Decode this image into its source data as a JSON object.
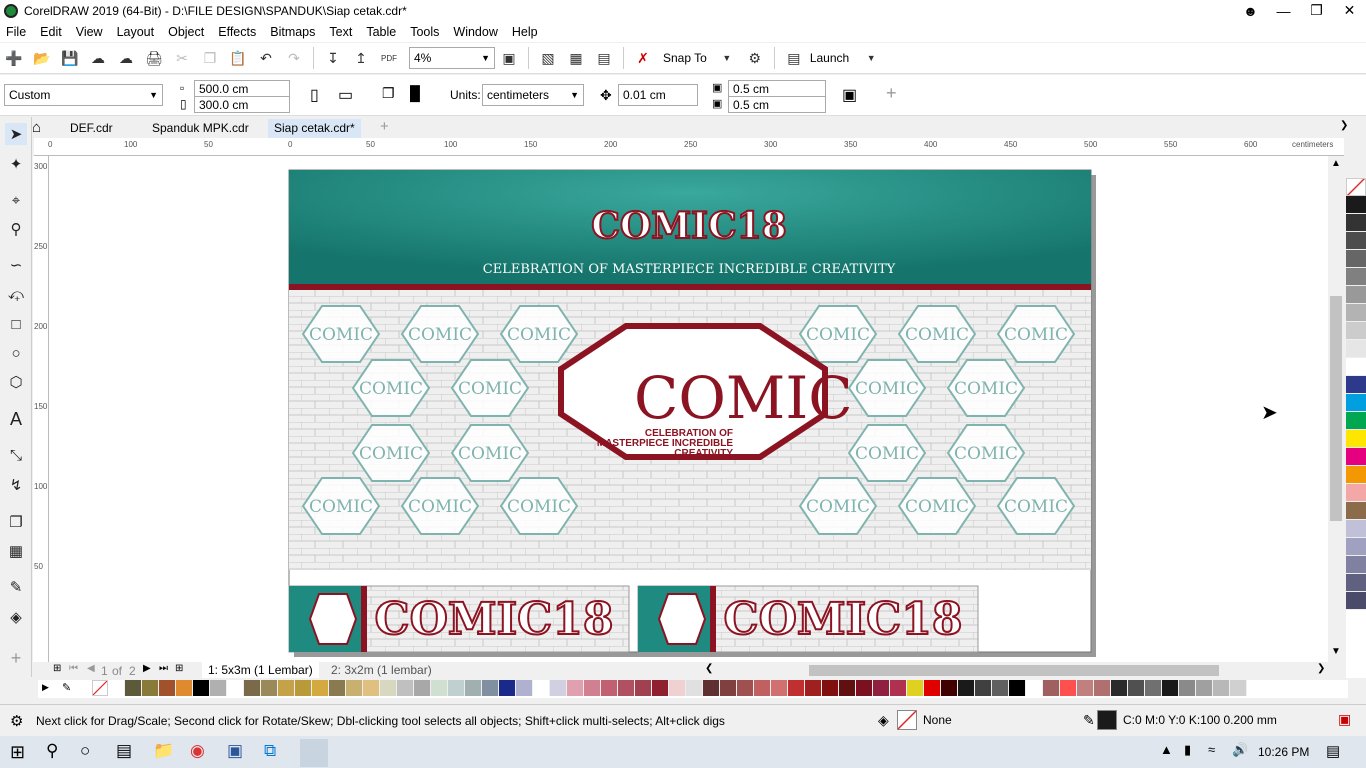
{
  "window": {
    "title": "CorelDRAW 2019 (64-Bit) - D:\\FILE DESIGN\\SPANDUK\\Siap cetak.cdr*"
  },
  "menu": [
    "File",
    "Edit",
    "View",
    "Layout",
    "Object",
    "Effects",
    "Bitmaps",
    "Text",
    "Table",
    "Tools",
    "Window",
    "Help"
  ],
  "toolbar": {
    "zoom": "4%",
    "snap_to": "Snap To",
    "launch": "Launch"
  },
  "property_bar": {
    "preset": "Custom",
    "width": "500.0 cm",
    "height": "300.0 cm",
    "units_label": "Units:",
    "units_value": "centimeters",
    "nudge": "0.01 cm",
    "dup_x": "0.5 cm",
    "dup_y": "0.5 cm"
  },
  "doc_tabs": [
    "DEF.cdr",
    "Spanduk MPK.cdr",
    "Siap cetak.cdr*"
  ],
  "ruler": {
    "unit": "centimeters",
    "h_ticks": [
      "0",
      "100",
      "50",
      "0",
      "50",
      "100",
      "150",
      "200",
      "250",
      "300",
      "350",
      "400",
      "450",
      "500",
      "550",
      "600"
    ],
    "v_ticks": [
      "300",
      "250",
      "200",
      "150",
      "100",
      "50"
    ]
  },
  "design": {
    "logo": "COMIC18",
    "tagline": "CELEBRATION OF MASTERPIECE INCREDIBLE CREATIVITY",
    "big_logo": "COMIC",
    "big_logo_sub": [
      "CELEBRATION OF",
      "MASTERPIECE INCREDIBLE",
      "CREATIVITY"
    ],
    "small_logo": "COMIC",
    "strip_text": "COMIC18"
  },
  "page_nav": {
    "counter": "1",
    "of": "of",
    "total": "2",
    "page1": "1: 5x3m (1 Lembar)",
    "page2": "2: 3x2m (1 lembar)"
  },
  "status": {
    "hint": "Next click for Drag/Scale; Second click for Rotate/Skew; Dbl-clicking tool selects all objects; Shift+click multi-selects; Alt+click digs",
    "fill": "None",
    "outline": "C:0 M:0 Y:0 K:100  0.200 mm"
  },
  "taskbar": {
    "time": "10:26 PM"
  },
  "colors": {
    "teal": "#1e8a80",
    "maroon": "#8c1422",
    "brick": "#ededed",
    "hex_outline": "#7fb3ae",
    "palette_right": [
      "#1a1a1a",
      "#333333",
      "#4d4d4d",
      "#666666",
      "#808080",
      "#999999",
      "#b3b3b3",
      "#cccccc",
      "#e6e6e6",
      "#ffffff",
      "#2d3a8c",
      "#00a0e0",
      "#00a650",
      "#ffe600",
      "#e4007f",
      "#f39800",
      "#f4a7a7",
      "#8b6b4a",
      "#c0c0d8",
      "#a0a0c0",
      "#8080a0",
      "#606080",
      "#4a4a6a"
    ],
    "palette_bottom": [
      "#ffffff",
      "#5c5a3a",
      "#8a7a3a",
      "#a0522d",
      "#e08a30",
      "#000000",
      "#b0b0b0",
      "#ffffff",
      "#7a6a4a",
      "#9a8a5a",
      "#c4a24a",
      "#b89a3a",
      "#d4aa40",
      "#8a7a50",
      "#c8b070",
      "#e0c080",
      "#d8d8c0",
      "#c0c0c0",
      "#a8a8a8",
      "#d0e0d0",
      "#c0d0d0",
      "#a0b0b0",
      "#8090a0",
      "#1a2a8a",
      "#b0b0d0",
      "#ffffff",
      "#d0d0e0",
      "#e0a0b0",
      "#d08090",
      "#c06070",
      "#b05060",
      "#a04050",
      "#902030",
      "#f0d0d0",
      "#e0e0e0",
      "#603030",
      "#804040",
      "#a05050",
      "#c06060",
      "#d07070",
      "#c03030",
      "#a02020",
      "#801010",
      "#601010",
      "#7a1020",
      "#902040",
      "#b03050",
      "#e0d020",
      "#e00000",
      "#400000",
      "#1a1a1a",
      "#404040",
      "#606060",
      "#000000",
      "#ffffff",
      "#a06060",
      "#ff5050",
      "#c08080",
      "#b07070",
      "#2a2a2a",
      "#505050",
      "#707070",
      "#1a1a1a",
      "#8a8a8a",
      "#a0a0a0",
      "#b8b8b8",
      "#d0d0d0"
    ]
  }
}
